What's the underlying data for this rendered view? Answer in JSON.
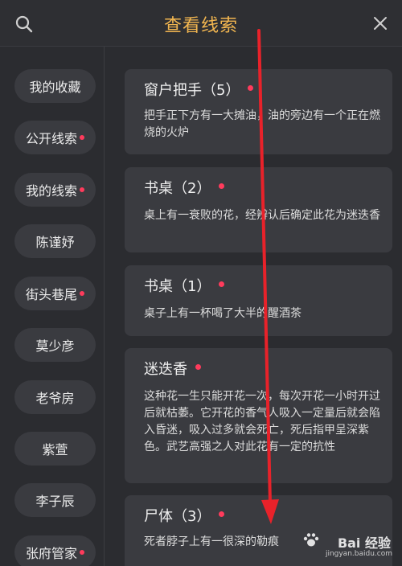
{
  "header": {
    "title": "查看线索",
    "search_icon": "search-icon",
    "close_icon": "close-icon",
    "title_color": "#f2b650"
  },
  "sidebar": {
    "items": [
      {
        "label": "我的收藏",
        "dot": false
      },
      {
        "label": "公开线索",
        "dot": true
      },
      {
        "label": "我的线索",
        "dot": true
      },
      {
        "label": "陈谨妤",
        "dot": false
      },
      {
        "label": "街头巷尾",
        "dot": true
      },
      {
        "label": "莫少彦",
        "dot": false
      },
      {
        "label": "老爷房",
        "dot": false
      },
      {
        "label": "紫萱",
        "dot": false
      },
      {
        "label": "李子辰",
        "dot": false
      },
      {
        "label": "张府管家",
        "dot": true
      }
    ]
  },
  "clues": [
    {
      "title": "窗户把手（5）",
      "desc": "把手正下方有一大摊油，油的旁边有一个正在燃烧的火炉",
      "dot": true
    },
    {
      "title": "书桌（2）",
      "desc": "桌上有一衰败的花，经辨认后确定此花为迷迭香",
      "dot": true
    },
    {
      "title": "书桌（1）",
      "desc": "桌子上有一杯喝了大半的醒酒茶",
      "dot": true
    },
    {
      "title": "迷迭香",
      "desc": "这种花一生只能开花一次，每次开花一小时开过后就枯萎。它开花的香气人吸入一定量后就会陷入昏迷，吸入过多就会死亡，死后指甲呈深紫色。武艺高强之人对此花有一定的抗性",
      "dot": true
    },
    {
      "title": "尸体（3）",
      "desc": "死者脖子上有一很深的勒痕",
      "dot": true
    }
  ],
  "watermark": {
    "brand": "Bai 经验",
    "url": "jingyan.baidu.com"
  },
  "colors": {
    "background": "#2b2c30",
    "card": "#3a3b40",
    "unread_dot": "#ff3b5c",
    "annotation_arrow": "#e8222a"
  }
}
